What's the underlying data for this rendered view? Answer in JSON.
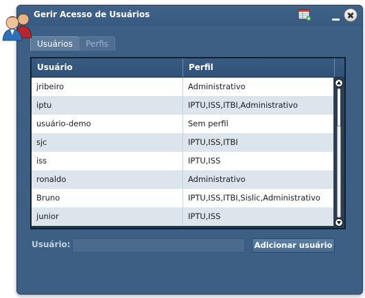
{
  "window": {
    "title": "Gerir Acesso de Usuários"
  },
  "tabs": [
    {
      "label": "Usuários",
      "active": true
    },
    {
      "label": "Perfis",
      "active": false
    }
  ],
  "table": {
    "columns": [
      "Usuário",
      "Perfil"
    ],
    "rows": [
      {
        "user": "jribeiro",
        "profile": "Administrativo"
      },
      {
        "user": "iptu",
        "profile": "IPTU,ISS,ITBI,Administrativo"
      },
      {
        "user": "usuário-demo",
        "profile": "Sem perfil"
      },
      {
        "user": "sjc",
        "profile": "IPTU,ISS,ITBI"
      },
      {
        "user": "iss",
        "profile": "IPTU,ISS"
      },
      {
        "user": "ronaldo",
        "profile": "Administrativo"
      },
      {
        "user": "Bruno",
        "profile": "IPTU,ISS,ITBI,Sislic,Administrativo"
      },
      {
        "user": "junior",
        "profile": "IPTU,ISS"
      }
    ]
  },
  "bottom": {
    "label": "Usuário:",
    "input_value": "",
    "add_button_label": "Adicionar usuário"
  },
  "icons": {
    "app": "users-icon",
    "toolbar": "table-edit-icon",
    "minimize": "minimize-icon",
    "close": "close-icon"
  },
  "colors": {
    "window_bg": "#3d5f84",
    "row_alt": "#dce4ec",
    "header_bg": "#2f5077"
  }
}
